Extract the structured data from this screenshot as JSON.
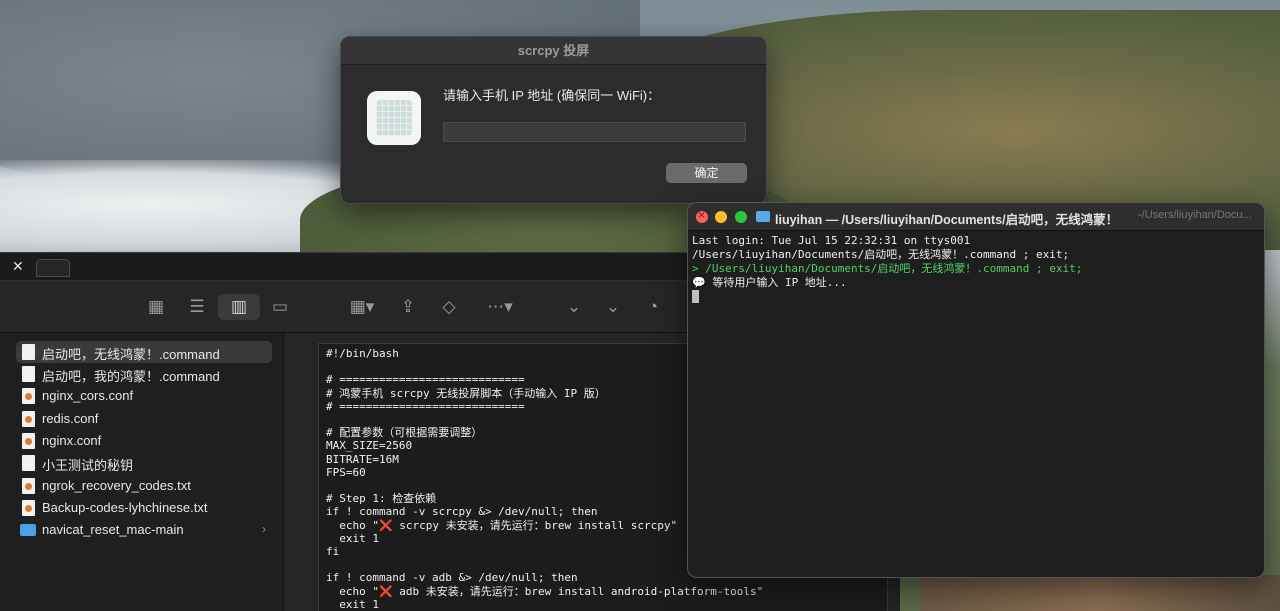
{
  "dialog": {
    "title": "scrcpy 投屏",
    "prompt": "请输入手机 IP 地址 (确保同一 WiFi)：",
    "input_value": "",
    "ok_label": "确定"
  },
  "terminal": {
    "title": "liuyihan — /Users/liuyihan/Documents/启动吧，无线鸿蒙！",
    "title_fade": "-/Users/liuyihan/Docu...",
    "lines": [
      "Last login: Tue Jul 15 22:32:31 on ttys001",
      "/Users/liuyihan/Documents/启动吧，无线鸿蒙！.command ; exit;",
      "> /Users/liuyihan/Documents/启动吧，无线鸿蒙！.command ; exit;",
      "💬 等待用户输入 IP 地址..."
    ]
  },
  "finder": {
    "tab_close": "✕",
    "files": [
      {
        "name": "启动吧，无线鸿蒙！.command",
        "kind": "doc"
      },
      {
        "name": "启动吧，我的鸿蒙！.command",
        "kind": "doc"
      },
      {
        "name": "nginx_cors.conf",
        "kind": "conf"
      },
      {
        "name": "redis.conf",
        "kind": "conf"
      },
      {
        "name": "nginx.conf",
        "kind": "conf"
      },
      {
        "name": "小王测试的秘钥",
        "kind": "doc"
      },
      {
        "name": "ngrok_recovery_codes.txt",
        "kind": "conf"
      },
      {
        "name": "Backup-codes-lyhchinese.txt",
        "kind": "conf"
      },
      {
        "name": "navicat_reset_mac-main",
        "kind": "folder"
      }
    ],
    "folder_chevron": "›",
    "toolbar_icons": [
      "grid-view-icon",
      "list-view-icon",
      "column-view-icon",
      "gallery-view-icon",
      "group-icon",
      "share-icon",
      "tag-icon",
      "more-icon",
      "chevron-down-icon",
      "chevron-down-icon",
      "markup-icon"
    ],
    "code": "#!/bin/bash\n\n# ============================\n# 鸿蒙手机 scrcpy 无线投屏脚本（手动输入 IP 版）\n# ============================\n\n# 配置参数（可根据需要调整）\nMAX_SIZE=2560\nBITRATE=16M\nFPS=60\n\n# Step 1: 检查依赖\nif ! command -v scrcpy &> /dev/null; then\n  echo \"❌ scrcpy 未安装，请先运行：brew install scrcpy\"\n  exit 1\nfi\n\nif ! command -v adb &> /dev/null; then\n  echo \"❌ adb 未安装，请先运行：brew install android-platform-tools\"\n  exit 1"
  }
}
